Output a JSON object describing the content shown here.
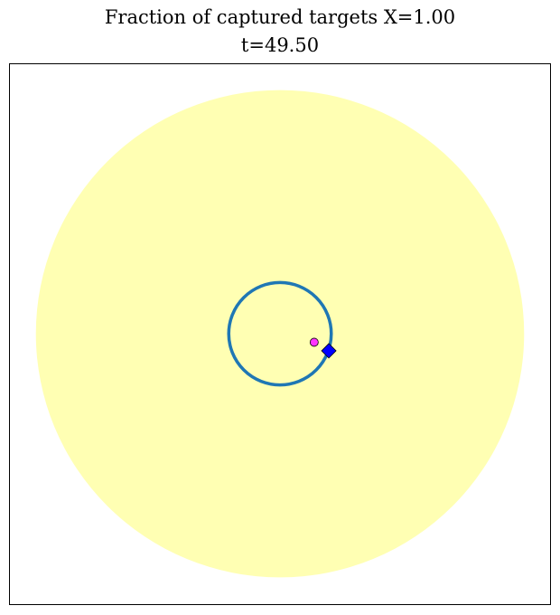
{
  "chart_data": {
    "type": "scatter",
    "title": "Fraction of captured targets X=1.00",
    "subtitle": "t=49.50",
    "xlabel": "",
    "ylabel": "",
    "axes_ticks": false,
    "grid": false,
    "region": {
      "shape": "circle",
      "center": [
        0,
        0
      ],
      "radius": 1.0,
      "color": "#ffffb3"
    },
    "trajectory": {
      "shape": "circle",
      "center": [
        0,
        0
      ],
      "radius": 0.21,
      "color": "#1f77b4"
    },
    "markers": [
      {
        "kind": "target",
        "shape": "circle",
        "x": 0.14,
        "y": -0.035,
        "color": "#ff33ff"
      },
      {
        "kind": "agent",
        "shape": "diamond",
        "x": 0.2,
        "y": -0.07,
        "color": "#0000ff"
      }
    ],
    "xlim": [
      -1.11,
      1.11
    ],
    "ylim": [
      -1.11,
      1.11
    ]
  }
}
